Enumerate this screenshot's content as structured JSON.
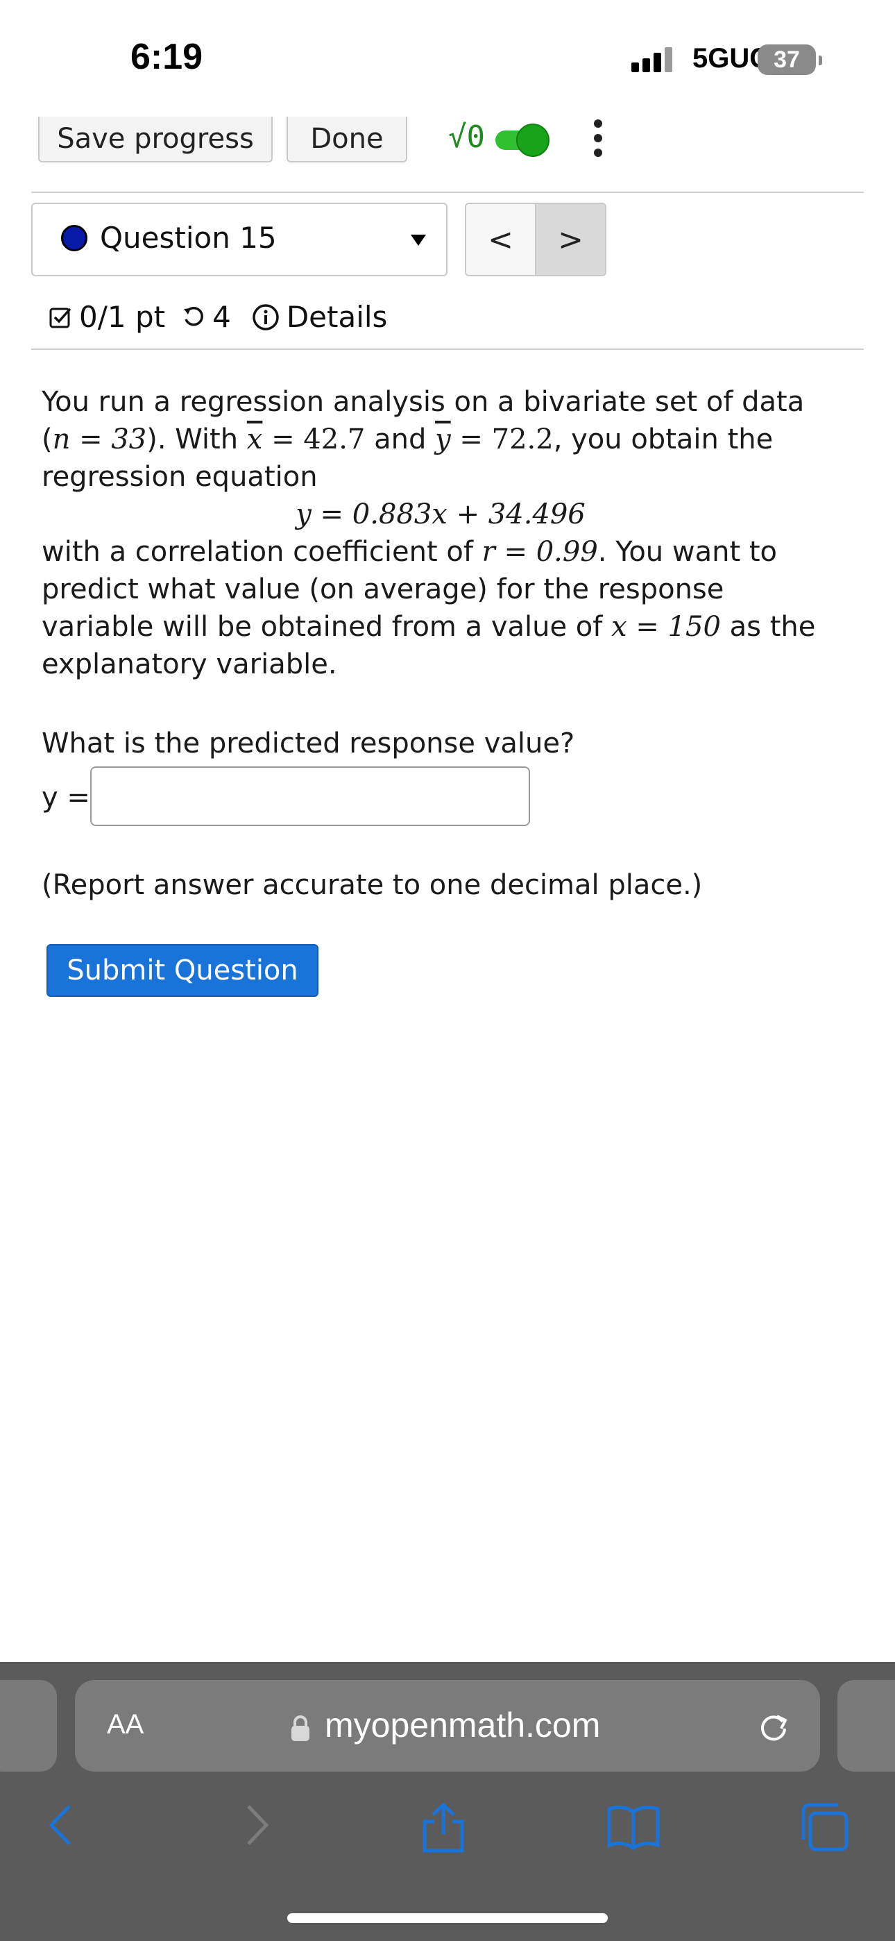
{
  "status_bar": {
    "time": "6:19",
    "network": "5GUC",
    "battery": "37"
  },
  "toolbar": {
    "save_label": "Save progress",
    "done_label": "Done",
    "vo_label": "√0"
  },
  "question_nav": {
    "selected": "Question 15",
    "prev": "<",
    "next": ">"
  },
  "score": {
    "points": "0/1 pt",
    "retries": "4",
    "details": "Details"
  },
  "question": {
    "p1_a": "You run a regression analysis on a bivariate set of data (",
    "p1_n": "n = 33",
    "p1_b": "). With ",
    "p1_xbar_sym": "x",
    "p1_xbar_val": " = 42.7",
    "p1_c": " and ",
    "p1_ybar_sym": "y",
    "p1_ybar_val": " = 72.2",
    "p1_d": ", you obtain the regression equation",
    "equation": "y = 0.883x + 34.496",
    "p2_a": "with a correlation coefficient of ",
    "p2_r": "r = 0.99",
    "p2_b": ". You want to predict what value (on average) for the response variable will be obtained from a value of ",
    "p2_x": "x = 150",
    "p2_c": " as the explanatory variable.",
    "prompt": "What is the predicted response value?",
    "answer_label": "y =",
    "answer_value": "",
    "note": "(Report answer accurate to one decimal place.)",
    "submit_label": "Submit Question"
  },
  "browser": {
    "aa_label": "AA",
    "url": "myopenmath.com"
  },
  "colors": {
    "accent": "#1a73d9",
    "toggle": "#2fbf2f",
    "safari_bg": "#5b5b5b"
  }
}
